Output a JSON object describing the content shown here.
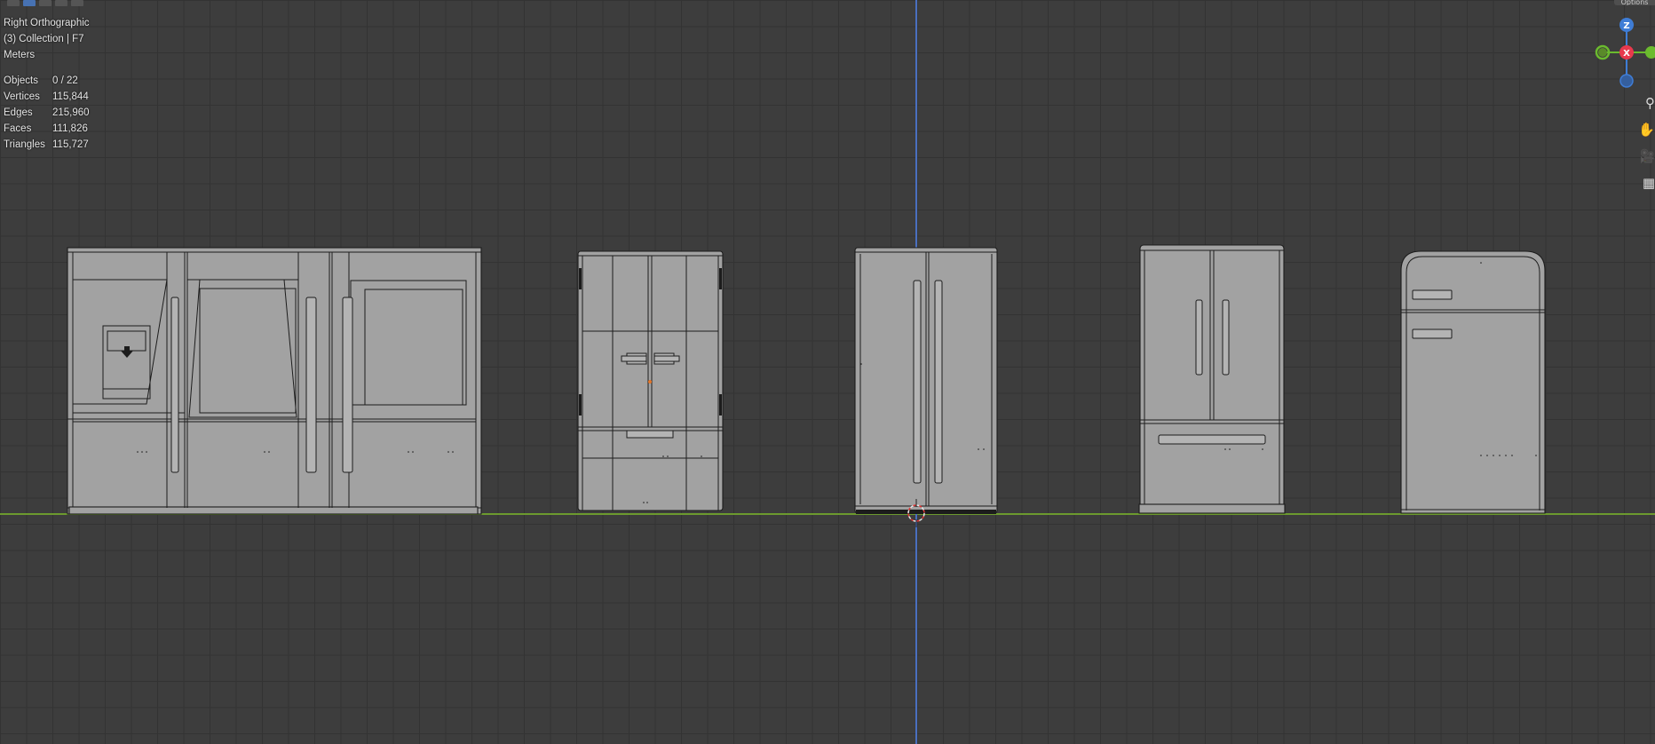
{
  "viewport": {
    "view_name": "Right Orthographic",
    "collection": "(3) Collection | F7",
    "units": "Meters"
  },
  "stats": [
    {
      "label": "Objects",
      "value": "0 / 22"
    },
    {
      "label": "Vertices",
      "value": "115,844"
    },
    {
      "label": "Edges",
      "value": "215,960"
    },
    {
      "label": "Faces",
      "value": "111,826"
    },
    {
      "label": "Triangles",
      "value": "115,727"
    }
  ],
  "gizmo": {
    "z_label": "Z",
    "x_label": "X",
    "colors": {
      "x": "#e8394d",
      "y": "#6bbb2e",
      "z": "#3f7dd6"
    }
  },
  "nav_tools": [
    {
      "name": "zoom-icon",
      "glyph": "⚲"
    },
    {
      "name": "pan-hand-icon",
      "glyph": "✋"
    },
    {
      "name": "camera-icon",
      "glyph": "🎥"
    },
    {
      "name": "ortho-grid-icon",
      "glyph": "▦"
    }
  ],
  "top_right_label": "Options",
  "colors": {
    "grid_bg": "#3d3d3d",
    "x_axis": "#6c9a2e",
    "z_axis": "#4a6fbf",
    "mesh_fill": "#a0a0a0",
    "mesh_edge": "#1a1a1a"
  }
}
